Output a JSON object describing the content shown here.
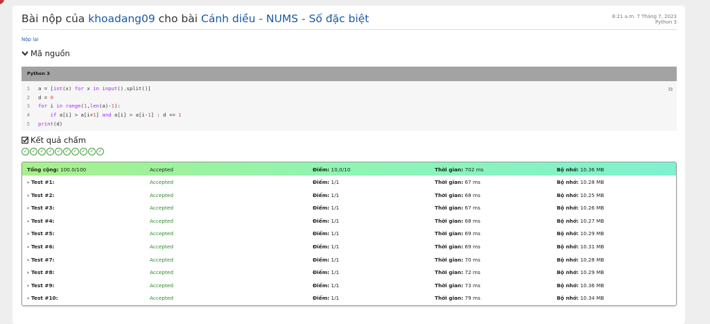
{
  "header": {
    "title_prefix": "Bài nộp của ",
    "user": "khoadang09",
    "title_mid": " cho bài ",
    "problem": "Cánh diều - NUMS - Số đặc biệt",
    "time": "8:21 a.m. 7 Tháng 7, 2023",
    "language": "Python 3"
  },
  "resubmit_label": "Nộp lại",
  "source_section": {
    "label": "Mã nguồn",
    "language": "Python 3"
  },
  "code_lines": [
    {
      "n": "1",
      "html": "a = [<span class=\"fn\">int</span>(x) <span class=\"kw\">for</span> x <span class=\"kw\">in</span> <span class=\"fn\">input</span>().split()]"
    },
    {
      "n": "2",
      "html": "d = <span class=\"num\">0</span>"
    },
    {
      "n": "3",
      "html": "<span class=\"kw\">for</span> i <span class=\"kw\">in</span> <span class=\"fn\">range</span>(<span class=\"num\">1</span>,<span class=\"fn\">len</span>(a)-<span class=\"num\">1</span>):"
    },
    {
      "n": "4",
      "html": "    <span class=\"kw\">if</span> a[i] &gt; a[i+<span class=\"num\">1</span>] <span class=\"kw\">and</span> a[i] &gt; a[i-<span class=\"num\">1</span>] : d += <span class=\"num\">1</span>"
    },
    {
      "n": "5",
      "html": "<span class=\"fn\">print</span>(d)"
    }
  ],
  "results_section": {
    "label": "Kết quả chấm",
    "check_count": 10
  },
  "labels": {
    "total": "Tổng cộng:",
    "score": "Điểm:",
    "time": "Thời gian:",
    "memory": "Bộ nhớ:"
  },
  "total_row": {
    "points": "100.0/100",
    "status": "Accepted",
    "score": "10,0/10",
    "time": "702 ms",
    "memory": "10.36 MB"
  },
  "tests": [
    {
      "name": "Test #1:",
      "status": "Accepted",
      "score": "1/1",
      "time": "67 ms",
      "memory": "10.28 MB"
    },
    {
      "name": "Test #2:",
      "status": "Accepted",
      "score": "1/1",
      "time": "68 ms",
      "memory": "10.25 MB"
    },
    {
      "name": "Test #3:",
      "status": "Accepted",
      "score": "1/1",
      "time": "67 ms",
      "memory": "10.26 MB"
    },
    {
      "name": "Test #4:",
      "status": "Accepted",
      "score": "1/1",
      "time": "68 ms",
      "memory": "10.27 MB"
    },
    {
      "name": "Test #5:",
      "status": "Accepted",
      "score": "1/1",
      "time": "69 ms",
      "memory": "10.29 MB"
    },
    {
      "name": "Test #6:",
      "status": "Accepted",
      "score": "1/1",
      "time": "69 ms",
      "memory": "10.31 MB"
    },
    {
      "name": "Test #7:",
      "status": "Accepted",
      "score": "1/1",
      "time": "70 ms",
      "memory": "10.28 MB"
    },
    {
      "name": "Test #8:",
      "status": "Accepted",
      "score": "1/1",
      "time": "72 ms",
      "memory": "10.29 MB"
    },
    {
      "name": "Test #9:",
      "status": "Accepted",
      "score": "1/1",
      "time": "73 ms",
      "memory": "10.36 MB"
    },
    {
      "name": "Test #10:",
      "status": "Accepted",
      "score": "1/1",
      "time": "79 ms",
      "memory": "10.34 MB"
    }
  ]
}
